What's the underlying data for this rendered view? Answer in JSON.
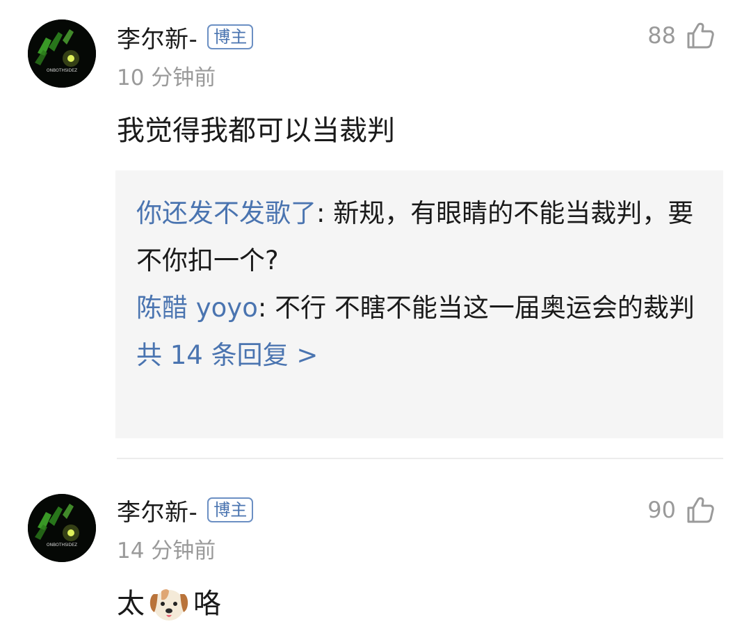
{
  "comments": [
    {
      "user": "李尔新-",
      "badge": "博主",
      "time": "10 分钟前",
      "likes": "88",
      "text": "我觉得我都可以当裁判",
      "avatar_text": "ONBOTHSIDEZ",
      "replies": [
        {
          "user": "你还发不发歌了",
          "sep": ": ",
          "text": "新规，有眼睛的不能当裁判，要不你扣一个?"
        },
        {
          "user": "陈醋 yoyo",
          "sep": ": ",
          "text": "不行 不瞎不能当这一届奥运会的裁判"
        }
      ],
      "more": "共 14 条回复 >"
    },
    {
      "user": "李尔新-",
      "badge": "博主",
      "time": "14 分钟前",
      "likes": "90",
      "text_before": "太",
      "text_after": "咯",
      "emoji": "dog-face",
      "avatar_text": "ONBOTHSIDEZ"
    }
  ],
  "colors": {
    "link_blue": "#4a74b0",
    "muted_gray": "#9a9a9a",
    "reply_bg": "#f5f5f5"
  }
}
